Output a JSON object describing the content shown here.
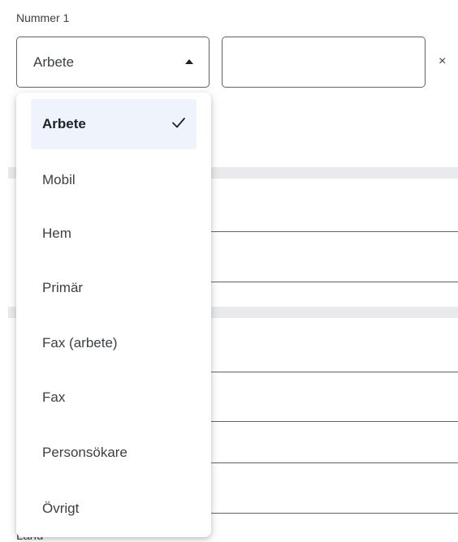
{
  "field": {
    "label": "Nummer 1",
    "type_value": "Arbete",
    "number_value": "",
    "remove_label": "×"
  },
  "dropdown": {
    "selected": "Arbete",
    "options": [
      "Arbete",
      "Mobil",
      "Hem",
      "Primär",
      "Fax (arbete)",
      "Fax",
      "Personsökare",
      "Övrigt"
    ]
  },
  "background": {
    "partial_label": "Land"
  },
  "colors": {
    "selected_bg": "#eef3fc",
    "border": "#5f6368",
    "band": "#e8eaed"
  }
}
